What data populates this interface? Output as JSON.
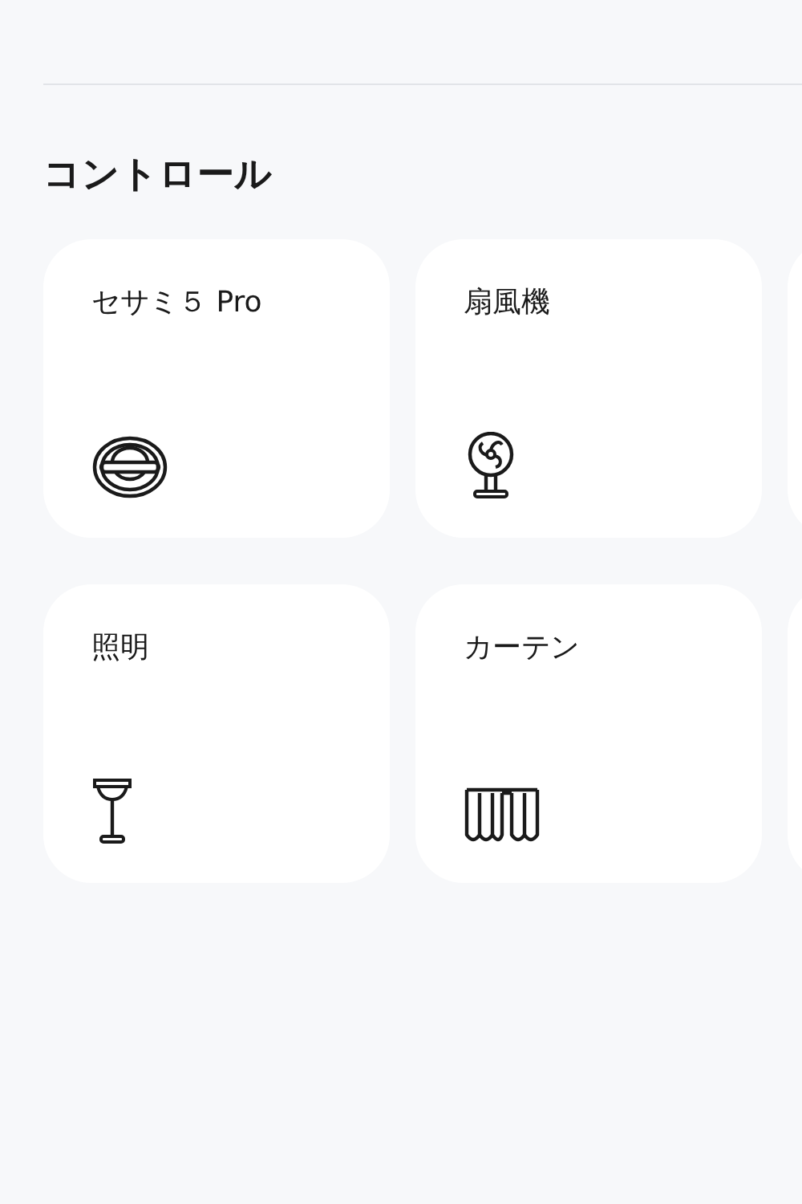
{
  "section": {
    "title": "コントロール"
  },
  "devices": [
    {
      "name": "セサミ５ Pro",
      "kind": "vacuum"
    },
    {
      "name": "扇風機",
      "kind": "fan"
    },
    {
      "name": "照明",
      "kind": "lamp"
    },
    {
      "name": "カーテン",
      "kind": "curtain"
    }
  ]
}
